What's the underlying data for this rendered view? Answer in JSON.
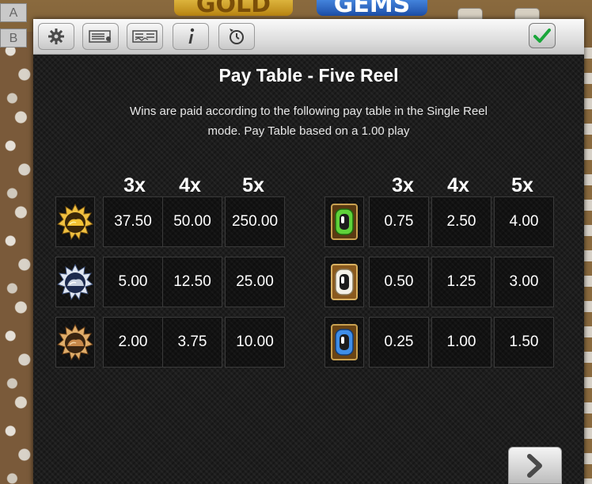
{
  "background": {
    "side_tab_a": "A",
    "side_tab_b": "B",
    "logo_gold": "GOLD",
    "logo_gems": "GEMS"
  },
  "toolbar": {
    "buttons": [
      {
        "icon": "gear-icon"
      },
      {
        "icon": "paylines-icon"
      },
      {
        "icon": "paytable-icon"
      },
      {
        "icon": "info-icon"
      },
      {
        "icon": "history-icon"
      }
    ],
    "ok_icon": "checkmark-icon",
    "ok_color": "#1aa63a"
  },
  "title": "Pay Table - Five Reel",
  "description_line1": "Wins are paid according to the following pay table in the Single Reel",
  "description_line2": "mode. Pay Table based on a 1.00 play",
  "left_table": {
    "headers": [
      "3x",
      "4x",
      "5x"
    ],
    "rows": [
      {
        "symbol": "gold-nugget-symbol",
        "values": [
          "37.50",
          "50.00",
          "250.00"
        ]
      },
      {
        "symbol": "silver-nugget-symbol",
        "values": [
          "5.00",
          "12.50",
          "25.00"
        ]
      },
      {
        "symbol": "bronze-nugget-symbol",
        "values": [
          "2.00",
          "3.75",
          "10.00"
        ]
      }
    ]
  },
  "right_table": {
    "headers": [
      "3x",
      "4x",
      "5x"
    ],
    "rows": [
      {
        "symbol": "green-gem-symbol",
        "values": [
          "0.75",
          "2.50",
          "4.00"
        ]
      },
      {
        "symbol": "white-gem-symbol",
        "values": [
          "0.50",
          "1.25",
          "3.00"
        ]
      },
      {
        "symbol": "blue-gem-symbol",
        "values": [
          "0.25",
          "1.00",
          "1.50"
        ]
      }
    ]
  },
  "next_icon": "chevron-right-icon"
}
